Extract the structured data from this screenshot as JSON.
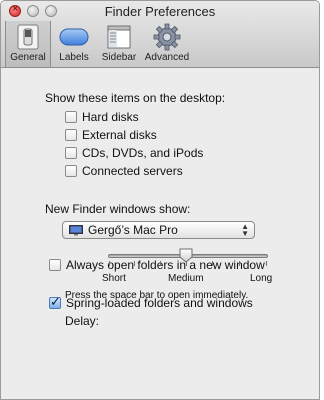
{
  "window": {
    "title": "Finder Preferences"
  },
  "tabs": [
    {
      "label": "General",
      "icon": "switch-icon",
      "active": true
    },
    {
      "label": "Labels",
      "icon": "label-pill-icon",
      "active": false
    },
    {
      "label": "Sidebar",
      "icon": "sidebar-window-icon",
      "active": false
    },
    {
      "label": "Advanced",
      "icon": "gear-icon",
      "active": false
    }
  ],
  "desktop": {
    "heading": "Show these items on the desktop:",
    "items": [
      {
        "label": "Hard disks",
        "checked": false
      },
      {
        "label": "External disks",
        "checked": false
      },
      {
        "label": "CDs, DVDs, and iPods",
        "checked": false
      },
      {
        "label": "Connected servers",
        "checked": false
      }
    ]
  },
  "new_window": {
    "heading": "New Finder windows show:",
    "selected": "Gergő’s Mac Pro",
    "icon": "computer-icon"
  },
  "always_open": {
    "label": "Always open folders in a new window",
    "checked": false
  },
  "spring_loaded": {
    "label": "Spring-loaded folders and windows",
    "checked": true,
    "delay_label": "Delay:",
    "delay_value": "Medium",
    "scale": [
      "Short",
      "Medium",
      "Long"
    ],
    "hint": "Press the space bar to open immediately."
  },
  "colors": {
    "accent": "#4a79b3",
    "close_button": "#d02525"
  }
}
